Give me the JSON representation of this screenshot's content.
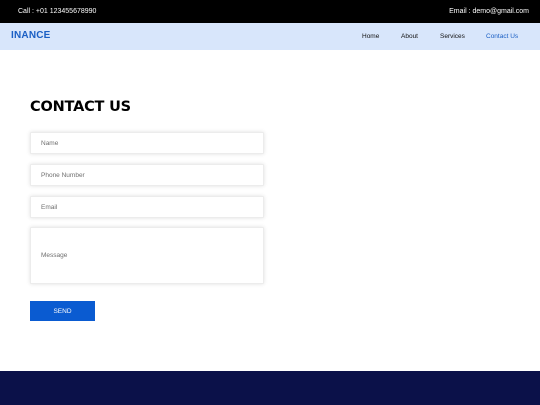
{
  "topbar": {
    "call": "Call : +01 123455678990",
    "email": "Email : demo@gmail.com"
  },
  "navbar": {
    "brand": "INANCE",
    "links": [
      {
        "label": "Home",
        "active": false
      },
      {
        "label": "About",
        "active": false
      },
      {
        "label": "Services",
        "active": false
      },
      {
        "label": "Contact Us",
        "active": true
      }
    ]
  },
  "contact": {
    "title": "CONTACT US",
    "name_placeholder": "Name",
    "phone_placeholder": "Phone Number",
    "email_placeholder": "Email",
    "message_placeholder": "Message",
    "send_label": "SEND"
  },
  "colors": {
    "topbar_bg": "#000000",
    "navbar_bg": "#d8e6fb",
    "brand": "#1a5fc4",
    "button": "#0a5bd1",
    "footer_bg": "#0b1149"
  }
}
